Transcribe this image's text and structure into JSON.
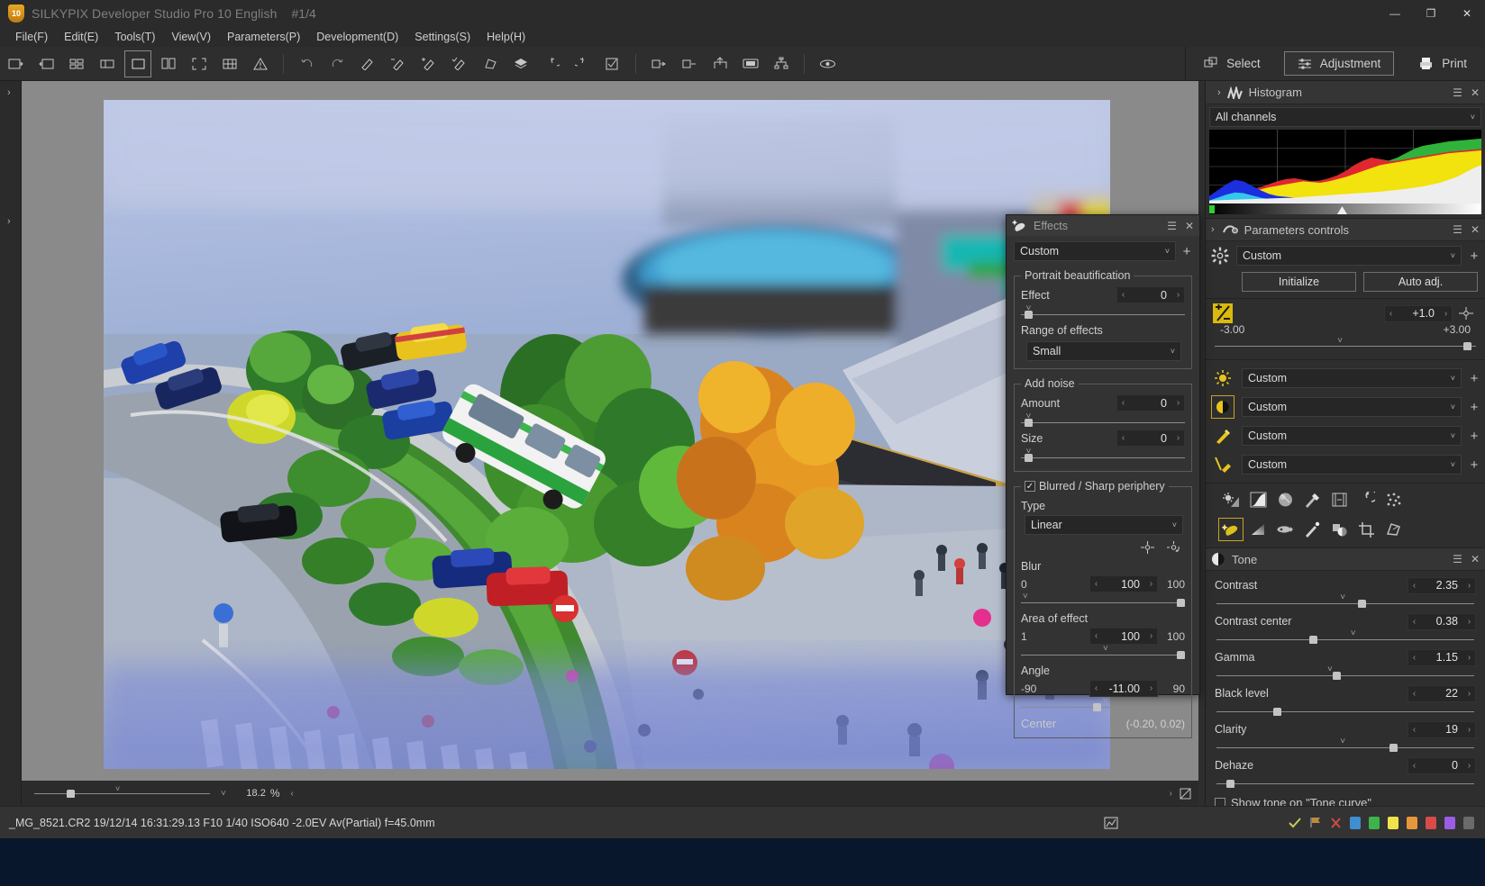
{
  "window": {
    "app_icon": "silkypix-badge-icon",
    "badge_text": "10",
    "title": "SILKYPIX Developer Studio Pro 10 English",
    "counter": "#1/4",
    "minimize": "—",
    "maximize": "❐",
    "close": "✕"
  },
  "menubar": {
    "items": [
      {
        "label": "File(F)"
      },
      {
        "label": "Edit(E)"
      },
      {
        "label": "Tools(T)"
      },
      {
        "label": "View(V)"
      },
      {
        "label": "Parameters(P)"
      },
      {
        "label": "Development(D)"
      },
      {
        "label": "Settings(S)"
      },
      {
        "label": "Help(H)"
      }
    ]
  },
  "toolbar": {
    "left_icons": [
      "open-folder-icon",
      "next-image-icon",
      "thumbnail-grid-icon",
      "thumbnail-detail-icon",
      "single-view-icon",
      "compare-two-icon",
      "fullscreen-icon",
      "multi-grid-icon",
      "warning-icon"
    ],
    "history_icons": [
      "undo-icon",
      "redo-icon"
    ],
    "edit_icons": [
      "pen-edit-icon",
      "pen-minus-icon",
      "pen-plus-icon",
      "pen-check-icon",
      "transform-icon",
      "layers-icon",
      "rotate-left-icon",
      "rotate-right-icon",
      "checkbox-icon"
    ],
    "output_icons": [
      "batch-develop-icon",
      "develop-one-icon",
      "export-icon",
      "slideshow-icon",
      "hierarchy-icon"
    ],
    "extra_icons": [
      "lens-profile-icon"
    ],
    "modes": [
      {
        "label": "Select",
        "icon": "select-icon",
        "active": false
      },
      {
        "label": "Adjustment",
        "icon": "sliders-icon",
        "active": true
      },
      {
        "label": "Print",
        "icon": "printer-icon",
        "active": false
      }
    ]
  },
  "viewer": {
    "zoom_value": "18.2",
    "zoom_unit": "%",
    "left_rail_arrows": [
      "›",
      "›"
    ],
    "fit_icon": "fit-to-window-icon"
  },
  "status": {
    "filename_info": "_MG_8521.CR2 19/12/14 16:31:29.13 F10 1/40 ISO640 -2.0EV Av(Partial) f=45.0mm",
    "right_icons": [
      "graph-icon",
      "check-icon",
      "flag-icon",
      "reject-icon",
      "rating-icon"
    ],
    "swatches": [
      "#3e8ed0",
      "#3cb44b",
      "#f0e24a",
      "#e8963c",
      "#d94a4a",
      "#9b5de5",
      "#6b6b6b"
    ]
  },
  "histogram_panel": {
    "title": "Histogram",
    "icon": "histogram-icon",
    "expand_icon": "chevron-right-icon",
    "menu_icon": "panel-menu-icon",
    "close_icon": "close-icon",
    "channel_select": "All channels"
  },
  "chart_data": {
    "type": "area",
    "title": "Histogram",
    "xlabel": "",
    "ylabel": "",
    "legend": [
      "Blue",
      "Yellow",
      "Red",
      "Green",
      "White"
    ],
    "x": [
      0,
      8,
      16,
      24,
      32,
      40,
      48,
      56,
      64,
      72,
      80,
      88,
      96,
      104,
      112,
      120,
      128,
      136,
      144,
      152,
      160,
      168,
      176,
      184,
      192,
      200,
      208,
      216,
      224,
      232,
      240,
      248,
      255
    ],
    "series": [
      {
        "name": "White",
        "values": [
          4,
          5,
          6,
          6,
          7,
          7,
          8,
          8,
          9,
          9,
          10,
          10,
          11,
          11,
          12,
          12,
          13,
          14,
          15,
          16,
          17,
          18,
          19,
          20,
          21,
          23,
          25,
          28,
          32,
          36,
          40,
          46,
          52
        ]
      },
      {
        "name": "Yellow",
        "values": [
          6,
          8,
          10,
          12,
          14,
          17,
          19,
          22,
          24,
          26,
          28,
          30,
          29,
          28,
          30,
          33,
          36,
          40,
          44,
          48,
          52,
          54,
          56,
          58,
          60,
          62,
          64,
          66,
          68,
          69,
          70,
          71,
          72
        ]
      },
      {
        "name": "Red",
        "values": [
          7,
          9,
          11,
          13,
          15,
          19,
          22,
          26,
          30,
          33,
          34,
          32,
          30,
          31,
          34,
          38,
          44,
          52,
          58,
          62,
          60,
          57,
          58,
          60,
          62,
          64,
          66,
          68,
          70,
          71,
          72,
          73,
          74
        ]
      },
      {
        "name": "Blue",
        "values": [
          10,
          18,
          26,
          32,
          30,
          24,
          18,
          13,
          10,
          9,
          8,
          8,
          7,
          7,
          7,
          7,
          7,
          7,
          7,
          7,
          7,
          7,
          7,
          7,
          7,
          7,
          7,
          7,
          7,
          7,
          7,
          7,
          7
        ]
      },
      {
        "name": "Green",
        "values": [
          7,
          9,
          11,
          13,
          15,
          19,
          22,
          26,
          30,
          33,
          34,
          32,
          30,
          31,
          34,
          38,
          44,
          52,
          58,
          62,
          60,
          58,
          62,
          68,
          74,
          78,
          80,
          82,
          84,
          85,
          86,
          87,
          88
        ]
      }
    ],
    "ylim": [
      0,
      100
    ],
    "xlim": [
      0,
      255
    ],
    "grid": true,
    "gridlines_x": 3,
    "gridlines_y": 3
  },
  "parameters_panel": {
    "title": "Parameters controls",
    "icon": "parameters-icon",
    "expand_icon": "chevron-right-icon",
    "menu_icon": "panel-menu-icon",
    "close_icon": "close-icon",
    "taste_select": "Custom",
    "gear_icon": "gear-icon",
    "add_icon": "plus-icon",
    "buttons": [
      {
        "label": "Initialize",
        "name": "initialize-button"
      },
      {
        "label": "Auto adj.",
        "name": "auto-adjust-button"
      }
    ],
    "exposure": {
      "icon": "exposure-bias-icon",
      "value": "+1.0",
      "min": "-3.00",
      "max": "+3.00",
      "target_icon": "exposure-target-icon"
    },
    "control_rows": [
      {
        "icon": "white-balance-icon",
        "value": "Custom",
        "selected": false
      },
      {
        "icon": "tone-contrast-icon",
        "value": "Custom",
        "selected": true
      },
      {
        "icon": "color-icon",
        "value": "Custom",
        "selected": false
      },
      {
        "icon": "sharpen-icon",
        "value": "Custom",
        "selected": false
      }
    ],
    "tool_icons_row1": [
      "exposure-tool-icon",
      "tone-curve-icon",
      "sphere-icon",
      "color-tool-icon",
      "hdr-icon",
      "rotate-tool-icon",
      "noise-reduction-icon"
    ],
    "tool_icons_row2": [
      "effects-tool-icon",
      "gradient-icon",
      "fisheye-icon",
      "brush-icon",
      "dodge-burn-icon",
      "crop-icon",
      "transform-tool-icon"
    ],
    "selected_tool_index": 0
  },
  "tone_panel": {
    "title": "Tone",
    "icon": "tone-icon",
    "expand_icon": "chevron-right-icon",
    "menu_icon": "panel-menu-icon",
    "close_icon": "close-icon",
    "rows": [
      {
        "label": "Contrast",
        "value": "2.35",
        "knob_pct": 55,
        "chev_pct": 48
      },
      {
        "label": "Contrast center",
        "value": "0.38",
        "knob_pct": 36,
        "chev_pct": 52
      },
      {
        "label": "Gamma",
        "value": "1.15",
        "knob_pct": 45,
        "chev_pct": 43
      },
      {
        "label": "Black level",
        "value": "22",
        "knob_pct": 22,
        "chev_pct": 0
      },
      {
        "label": "Clarity",
        "value": "19",
        "knob_pct": 67,
        "chev_pct": 48
      },
      {
        "label": "Dehaze",
        "value": "0",
        "knob_pct": 4,
        "chev_pct": 0
      }
    ],
    "checkbox": {
      "label": "Show tone on \"Tone curve\"",
      "checked": false
    }
  },
  "effects_window": {
    "title": "Effects",
    "icon": "effects-icon",
    "menu_icon": "panel-menu-icon",
    "close_icon": "close-icon",
    "taste_select": "Custom",
    "add_icon": "plus-icon",
    "portrait": {
      "legend": "Portrait beautification",
      "effect_label": "Effect",
      "effect_value": "0",
      "effect_knob_pct": 4,
      "effect_chev_pct": 4,
      "range_label": "Range of effects",
      "range_value": "Small"
    },
    "noise": {
      "legend": "Add noise",
      "amount_label": "Amount",
      "amount_value": "0",
      "amount_knob_pct": 4,
      "amount_chev_pct": 4,
      "size_label": "Size",
      "size_value": "0",
      "size_knob_pct": 4,
      "size_chev_pct": 4
    },
    "periphery": {
      "legend": "Blurred / Sharp periphery",
      "checked": true,
      "type_label": "Type",
      "type_value": "Linear",
      "target_icons": [
        "center-target-icon",
        "rotate-target-icon"
      ],
      "blur": {
        "label": "Blur",
        "value": "100",
        "min": "0",
        "max": "100",
        "knob_pct": 100,
        "chev_pct": 4
      },
      "area": {
        "label": "Area of effect",
        "value": "100",
        "min": "1",
        "max": "100",
        "knob_pct": 100,
        "chev_pct": 52
      },
      "angle": {
        "label": "Angle",
        "value": "-11.00",
        "min": "-90",
        "max": "90",
        "knob_pct": 44,
        "chev_pct": 52
      },
      "center_label": "Center",
      "center_value": "(-0.20, 0.02)"
    }
  },
  "colors": {
    "accent_gold": "#c9a227",
    "panel_bg": "#2e2e2e",
    "header_bg": "#353535",
    "field_bg": "#262626"
  }
}
